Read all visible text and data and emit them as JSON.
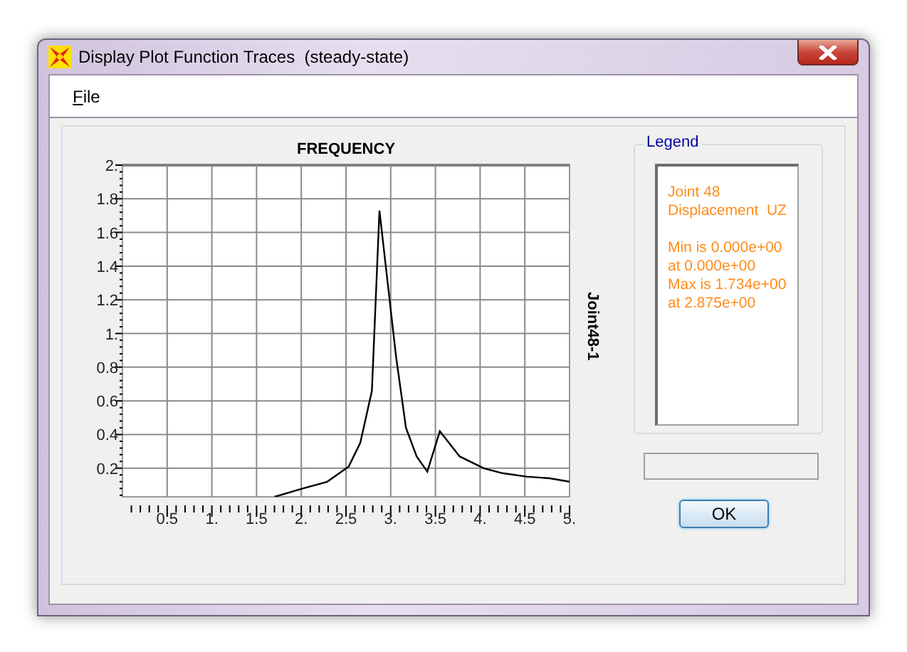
{
  "window": {
    "title": "Display Plot Function Traces  (steady-state)"
  },
  "menu": [
    {
      "label": "File"
    }
  ],
  "plot": {
    "chart_data": {
      "type": "line",
      "title": "FREQUENCY",
      "xlim": [
        0,
        5
      ],
      "ylim": [
        0.03,
        2
      ],
      "grid": true,
      "xticks": [
        {
          "value": 0.5,
          "label": "0.5"
        },
        {
          "value": 1,
          "label": "1."
        },
        {
          "value": 1.5,
          "label": "1.5"
        },
        {
          "value": 2,
          "label": "2."
        },
        {
          "value": 2.5,
          "label": "2.5"
        },
        {
          "value": 3,
          "label": "3."
        },
        {
          "value": 3.5,
          "label": "3.5"
        },
        {
          "value": 4,
          "label": "4."
        },
        {
          "value": 4.5,
          "label": "4.5"
        },
        {
          "value": 5,
          "label": "5."
        }
      ],
      "yticks": [
        {
          "value": 0.2,
          "label": "0.2"
        },
        {
          "value": 0.4,
          "label": "0.4"
        },
        {
          "value": 0.6,
          "label": "0.6"
        },
        {
          "value": 0.8,
          "label": "0.8"
        },
        {
          "value": 1,
          "label": "1."
        },
        {
          "value": 1.2,
          "label": "1.2"
        },
        {
          "value": 1.4,
          "label": "1.4"
        },
        {
          "value": 1.6,
          "label": "1.6"
        },
        {
          "value": 1.8,
          "label": "1.8"
        },
        {
          "value": 2,
          "label": "2."
        }
      ],
      "x": [
        1.7,
        2.02,
        2.29,
        2.53,
        2.66,
        2.79,
        2.875,
        3.06,
        3.17,
        3.29,
        3.41,
        3.55,
        3.77,
        4.04,
        4.25,
        4.52,
        4.78,
        5.0
      ],
      "series": [
        {
          "name": "Joint48-1",
          "color": "#000000",
          "values": [
            0.03,
            0.08,
            0.12,
            0.21,
            0.35,
            0.66,
            1.73,
            0.86,
            0.44,
            0.27,
            0.18,
            0.42,
            0.27,
            0.2,
            0.17,
            0.15,
            0.14,
            0.12
          ]
        }
      ]
    }
  },
  "legend": {
    "title": "Legend",
    "groups": [
      [
        "Joint 48",
        "Displacement  UZ"
      ],
      [
        "Min is 0.000e+00",
        "at 0.000e+00",
        "Max is 1.734e+00",
        "at 2.875e+00"
      ]
    ]
  },
  "buttons": [
    {
      "label": "OK"
    }
  ]
}
